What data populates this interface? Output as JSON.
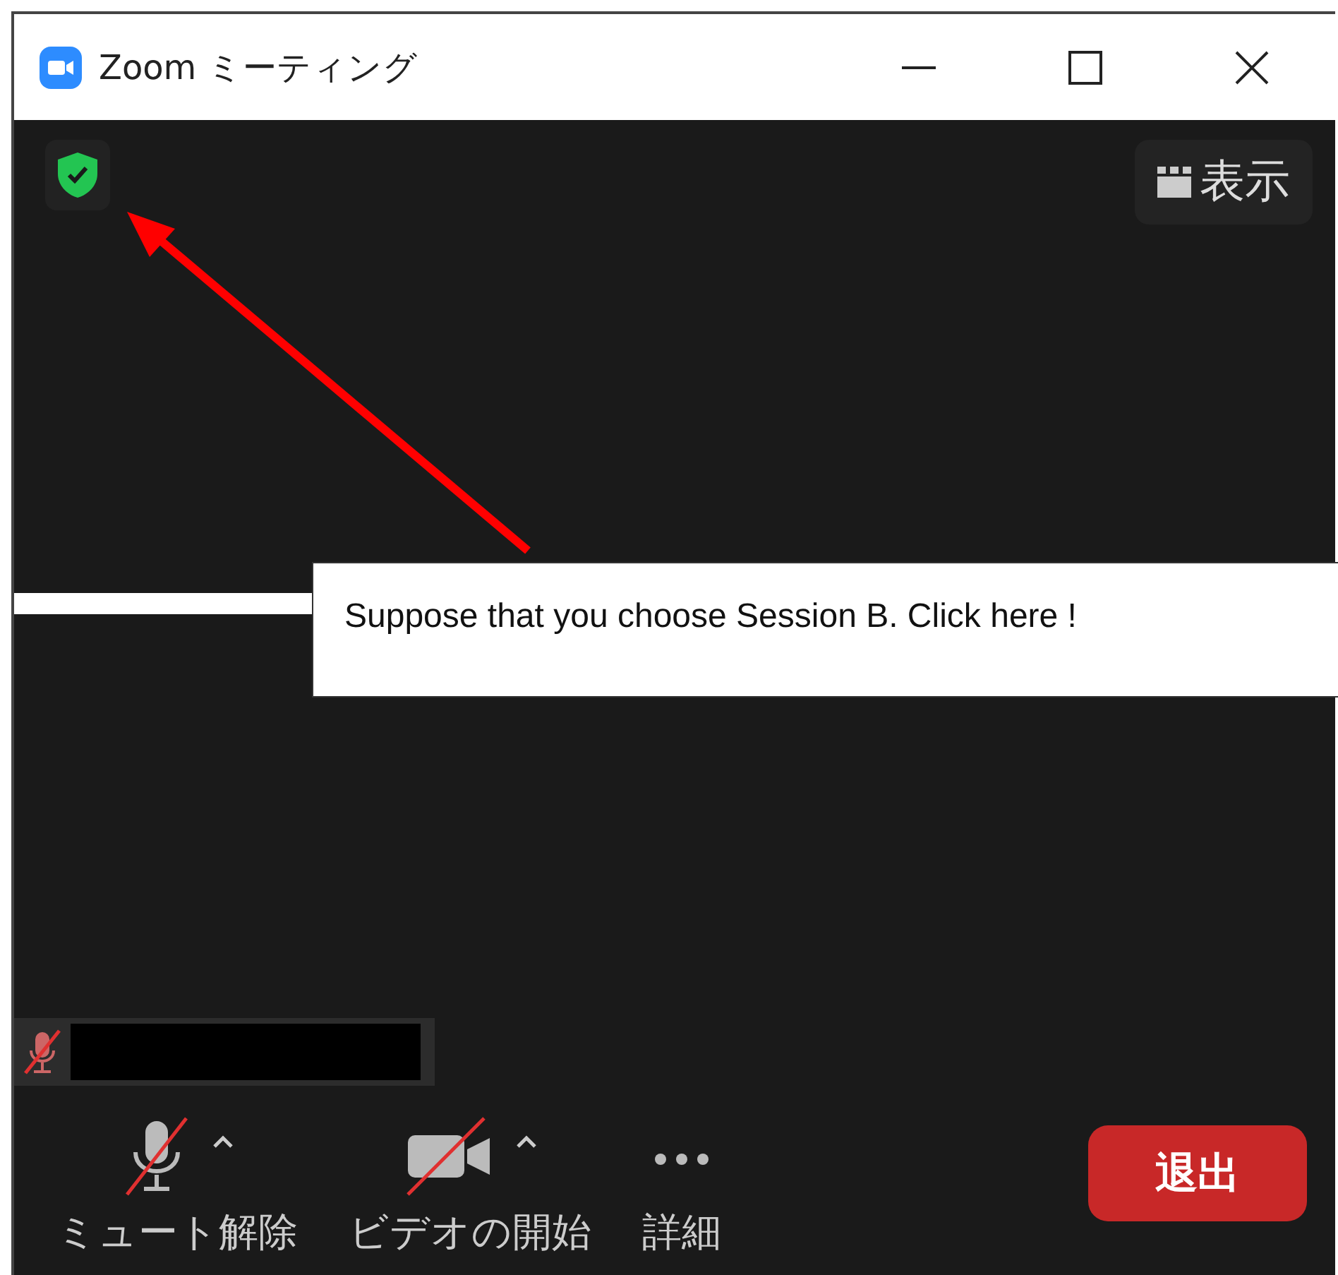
{
  "window": {
    "title": "Zoom ミーティング"
  },
  "view_button": {
    "label": "表示"
  },
  "callout": {
    "text": "Suppose that you choose Session B. Click here !"
  },
  "name_tag": {
    "muted": true
  },
  "toolbar": [
    {
      "kind": "audio",
      "label": "ミュート解除",
      "off": true,
      "has_menu": true
    },
    {
      "kind": "video",
      "label": "ビデオの開始",
      "off": true,
      "has_menu": true
    },
    {
      "kind": "more",
      "label": "詳細",
      "off": false,
      "has_menu": false
    }
  ],
  "leave_button": {
    "label": "退出"
  }
}
